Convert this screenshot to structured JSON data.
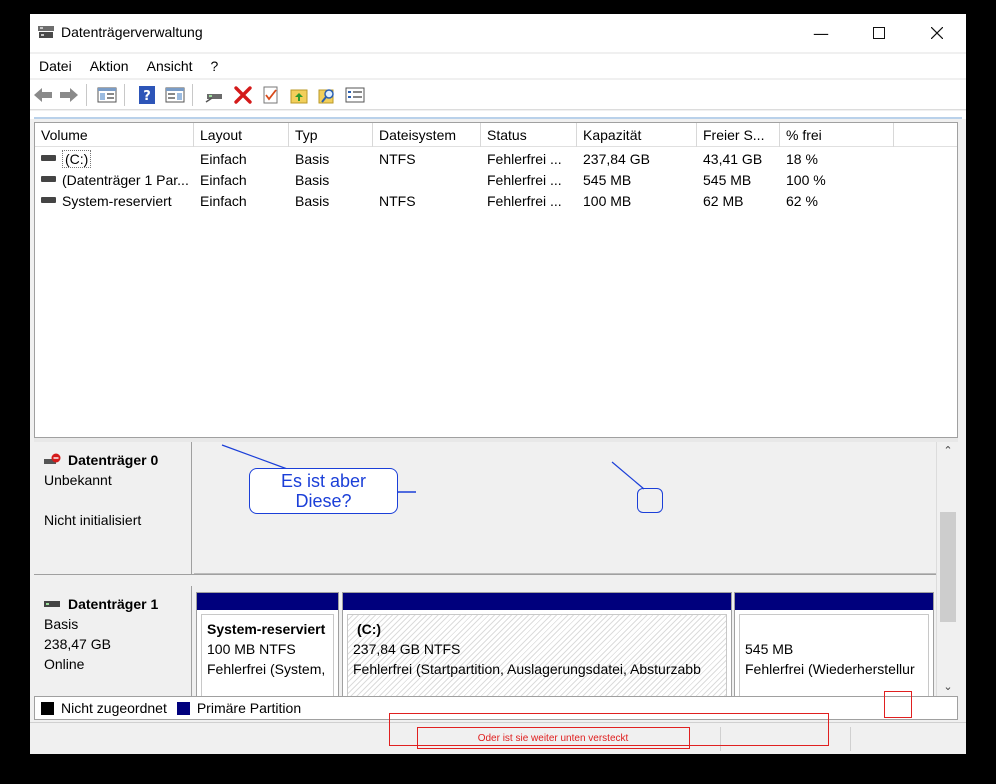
{
  "window": {
    "title": "Datenträgerverwaltung"
  },
  "menu": [
    "Datei",
    "Aktion",
    "Ansicht",
    "?"
  ],
  "toolbar": [
    "back-icon",
    "forward-icon",
    "show-hide-console-tree-icon",
    "help-icon",
    "show-hide-action-pane-icon",
    "connect-drive-icon",
    "delete-icon",
    "check-icon",
    "up-folder-icon",
    "search-icon",
    "properties-icon"
  ],
  "columns": [
    "Volume",
    "Layout",
    "Typ",
    "Dateisystem",
    "Status",
    "Kapazität",
    "Freier S...",
    "% frei"
  ],
  "volumes": [
    {
      "volume": "(C:)",
      "layout": "Einfach",
      "typ": "Basis",
      "fs": "NTFS",
      "status": "Fehlerfrei ...",
      "cap": "237,84 GB",
      "free": "43,41 GB",
      "pct": "18 %"
    },
    {
      "volume": "(Datenträger 1 Par...",
      "layout": "Einfach",
      "typ": "Basis",
      "fs": "",
      "status": "Fehlerfrei ...",
      "cap": "545 MB",
      "free": "545 MB",
      "pct": "100 %"
    },
    {
      "volume": "System-reserviert",
      "layout": "Einfach",
      "typ": "Basis",
      "fs": "NTFS",
      "status": "Fehlerfrei ...",
      "cap": "100 MB",
      "free": "62 MB",
      "pct": "62 %"
    }
  ],
  "disk0": {
    "name": "Datenträger 0",
    "type": "Unbekannt",
    "state": "Nicht initialisiert"
  },
  "disk1": {
    "name": "Datenträger 1",
    "type": "Basis",
    "size": "238,47 GB",
    "state": "Online",
    "partitions": [
      {
        "name": "System-reserviert",
        "fs": "100 MB NTFS",
        "status": "Fehlerfrei (System,"
      },
      {
        "name": "(C:)",
        "fs": "237,84 GB NTFS",
        "status": "Fehlerfrei (Startpartition, Auslagerungsdatei, Absturzabb"
      },
      {
        "name": "",
        "fs": "545 MB",
        "status": "Fehlerfrei (Wiederherstellur"
      }
    ]
  },
  "legend": [
    "Nicht zugeordnet",
    "Primäre Partition"
  ],
  "colors": {
    "unallocated": "#000000",
    "primary": "#00007d",
    "annotation_red": "#e02020",
    "annotation_blue": "#1b3fd8"
  },
  "annotations": {
    "callout_line1": "Es ist aber",
    "callout_line2": "Diese?",
    "hidden_text": "Oder ist sie weiter unten versteckt"
  }
}
